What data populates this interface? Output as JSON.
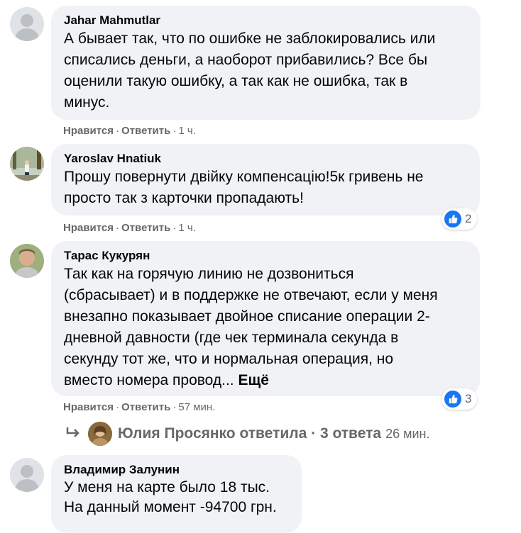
{
  "comments": [
    {
      "author": "Jahar Mahmutlar",
      "text": "А бывает так, что по ошибке не заблокировались или\nсписались деньги, а наоборот прибавились? Все бы\nоценили такую ошибку, а так как не ошибка, так в\nминус.",
      "like": "Нравится",
      "reply": "Ответить",
      "time": "1 ч."
    },
    {
      "author": "Yaroslav Hnatiuk",
      "text": "Прошу повернути двійку компенсацію!5к гривень не\nпросто так з карточки пропадають!",
      "like": "Нравится",
      "reply": "Ответить",
      "time": "1 ч.",
      "reaction_count": "2"
    },
    {
      "author": "Тарас Кукурян",
      "text": "Так как на горячую линию не дозвониться\n(сбрасывает) и в поддержке не отвечают, если у меня\nвнезапно показывает двойное списание операции 2-\nдневной давности (где чек терминала секунда в\nсекунду тот же, что и нормальная операция, но\nвместо номера провод... ",
      "more": "Ещё",
      "like": "Нравится",
      "reply": "Ответить",
      "time": "57 мин.",
      "reaction_count": "3"
    },
    {
      "author": "Владимир Залунин",
      "text": "У меня на карте было 18 тыс.\nНа данный момент -94700 грн."
    }
  ],
  "replies_row": {
    "text": "Юлия Просянко ответила · 3 ответа",
    "time": "26 мин."
  },
  "separator": "·",
  "colors": {
    "bubble": "#f0f2f5",
    "secondary_text": "#65676b",
    "like_blue": "#1877f2"
  },
  "icons": [
    "default-avatar-icon",
    "like-icon",
    "reply-arrow-icon"
  ]
}
